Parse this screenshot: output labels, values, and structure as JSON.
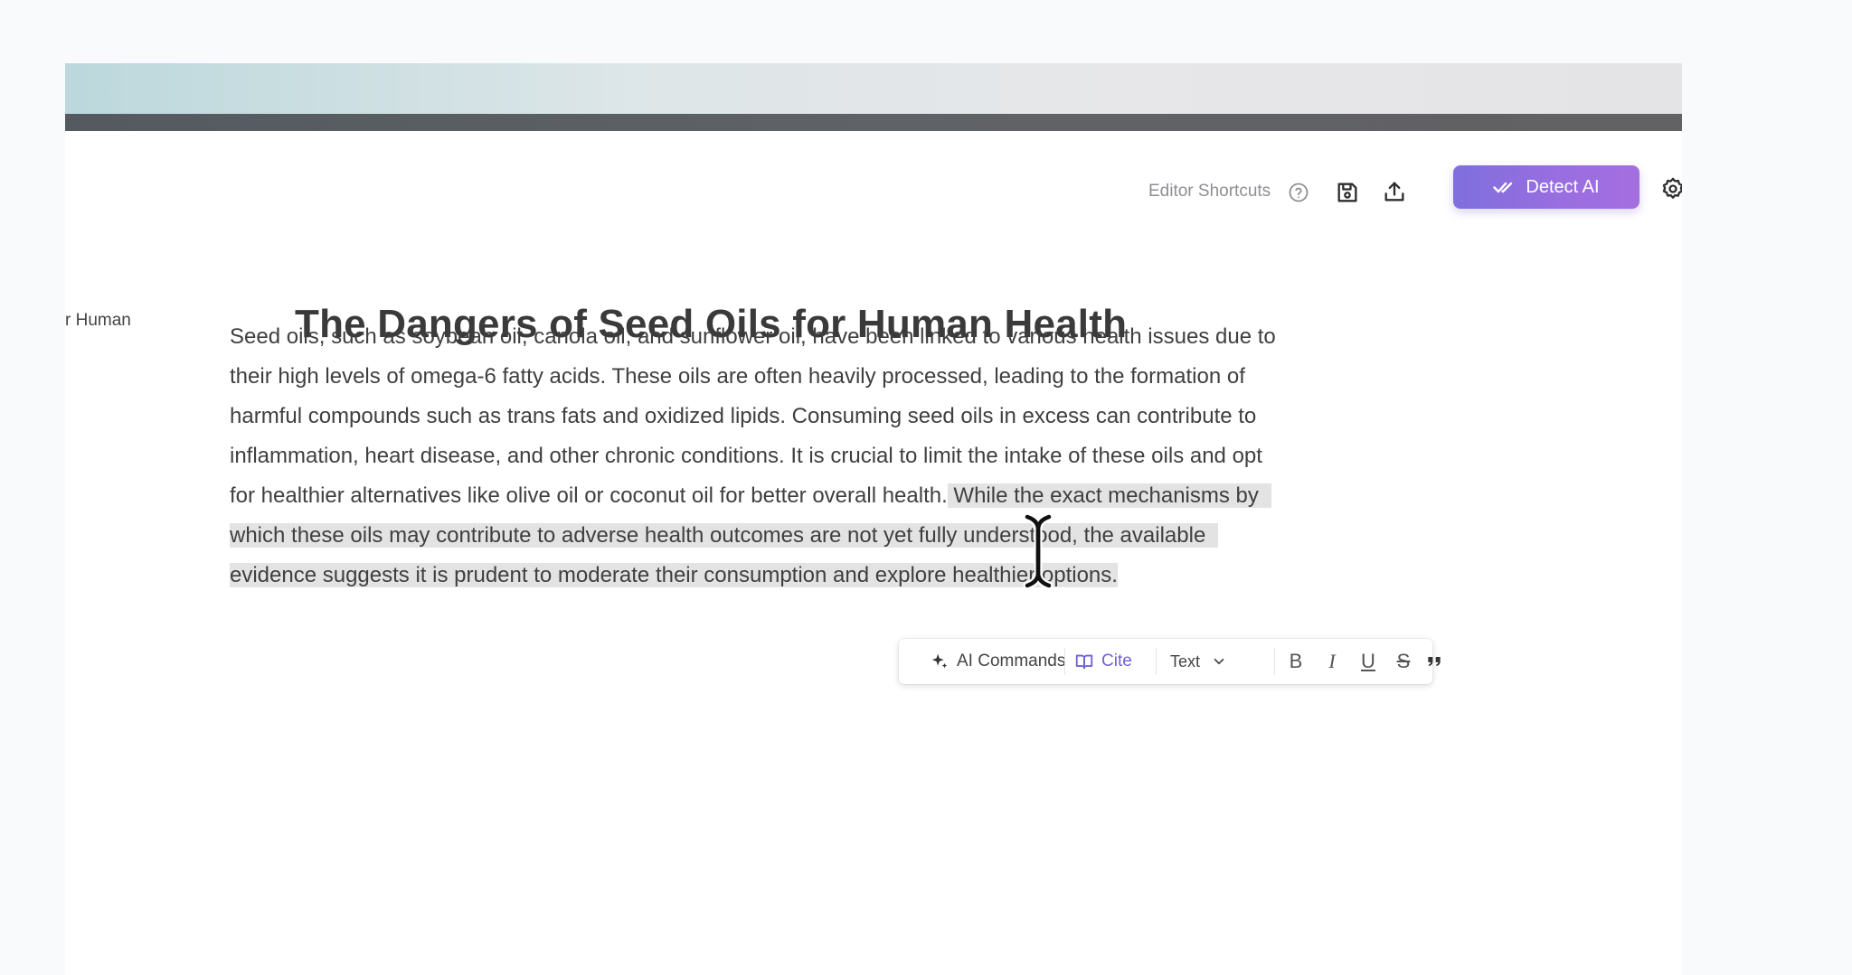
{
  "editor": {
    "side_label": "r Human",
    "toolbar": {
      "shortcuts_label": "Editor Shortcuts",
      "detect_label": "Detect AI"
    },
    "document": {
      "title": "The Dangers of Seed Oils for Human Health",
      "lines": [
        "Seed oils, such as soybean oil, canola oil, and sunflower oil, have been linked to various health issues due to",
        "their high levels of omega-6 fatty acids. These oils are often heavily processed, leading to the formation of",
        "harmful compounds such as trans fats and oxidized lipids. Consuming seed oils in excess can contribute to",
        "inflammation, heart disease, and other chronic conditions. It is crucial to limit the intake of these oils and opt"
      ],
      "line5_plain": "for healthier alternatives like olive oil or coconut oil for better overall health.",
      "line5_selected": " While the exact mechanisms by",
      "line6_selected": "which these oils may contribute to adverse health outcomes are not yet fully understood, the available",
      "line7_selected": "evidence suggests it is prudent to moderate their consumption and explore healthier options."
    },
    "format_bar": {
      "ai_commands_label": "AI Commands",
      "cite_label": "Cite",
      "text_style_label": "Text",
      "bold_glyph": "B",
      "italic_glyph": "I",
      "underline_glyph": "U",
      "strike_glyph": "S"
    }
  },
  "colors": {
    "accent_start": "#7f6fdd",
    "accent_end": "#a46ee0",
    "cite": "#6f62d8",
    "selection": "#e3e3e3"
  }
}
